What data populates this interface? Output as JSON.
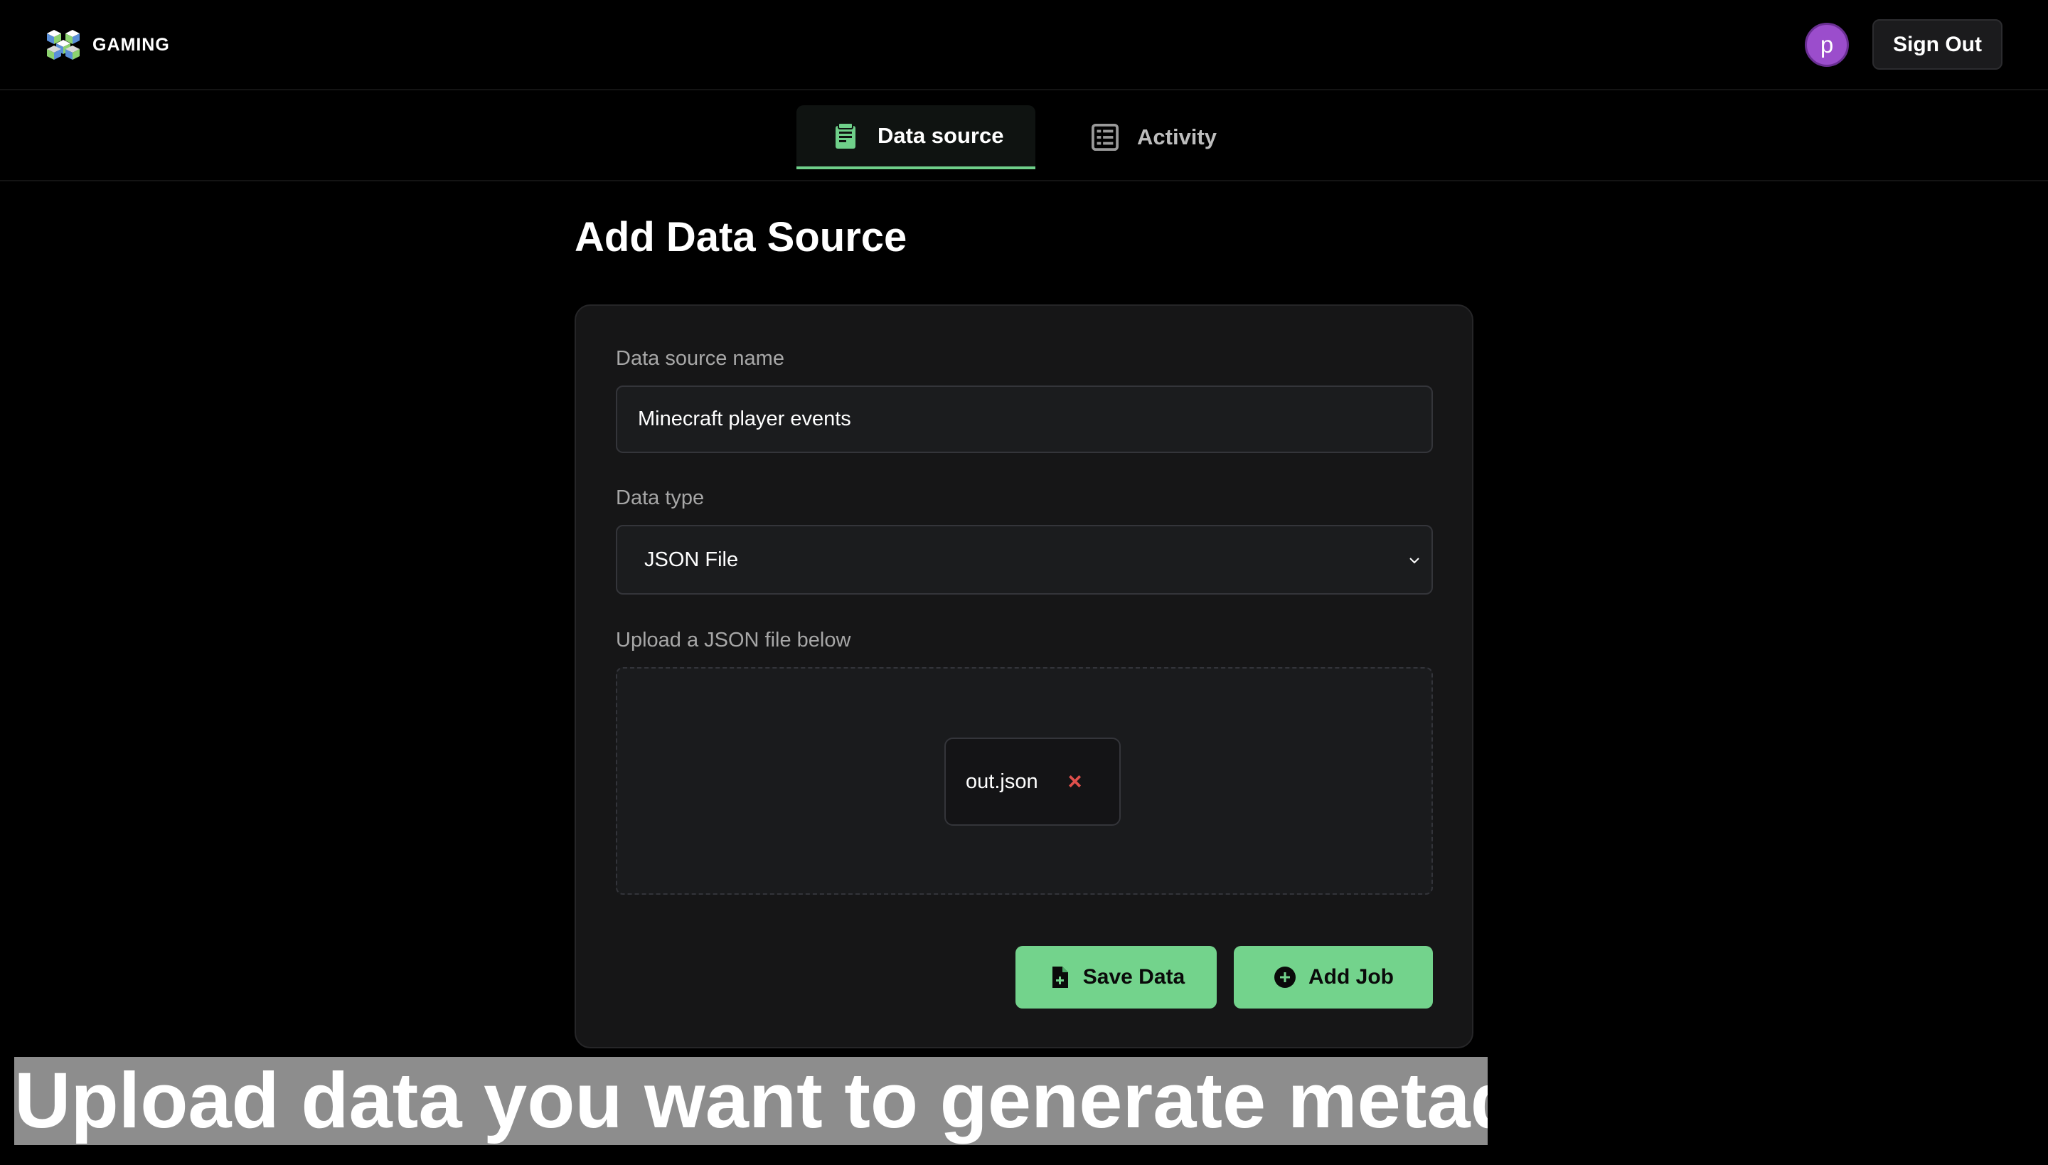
{
  "header": {
    "logo_text": "GAMING",
    "avatar_initial": "p",
    "sign_out_label": "Sign Out"
  },
  "tabs": [
    {
      "label": "Data source",
      "icon": "database-icon",
      "active": true
    },
    {
      "label": "Activity",
      "icon": "table-list-icon",
      "active": false
    }
  ],
  "main": {
    "title": "Add Data Source",
    "form": {
      "name_label": "Data source name",
      "name_value": "Minecraft player events",
      "type_label": "Data type",
      "type_value": "JSON File",
      "upload_label": "Upload a JSON file below",
      "file_name": "out.json",
      "remove_symbol": "×"
    },
    "buttons": {
      "save_label": "Save Data",
      "add_job_label": "Add Job"
    }
  },
  "caption": "Upload data you want to generate metadata",
  "colors": {
    "accent": "#73d38c",
    "avatar": "#9b4dcc",
    "remove": "#e0504c",
    "background": "#000000",
    "card": "#161617"
  }
}
